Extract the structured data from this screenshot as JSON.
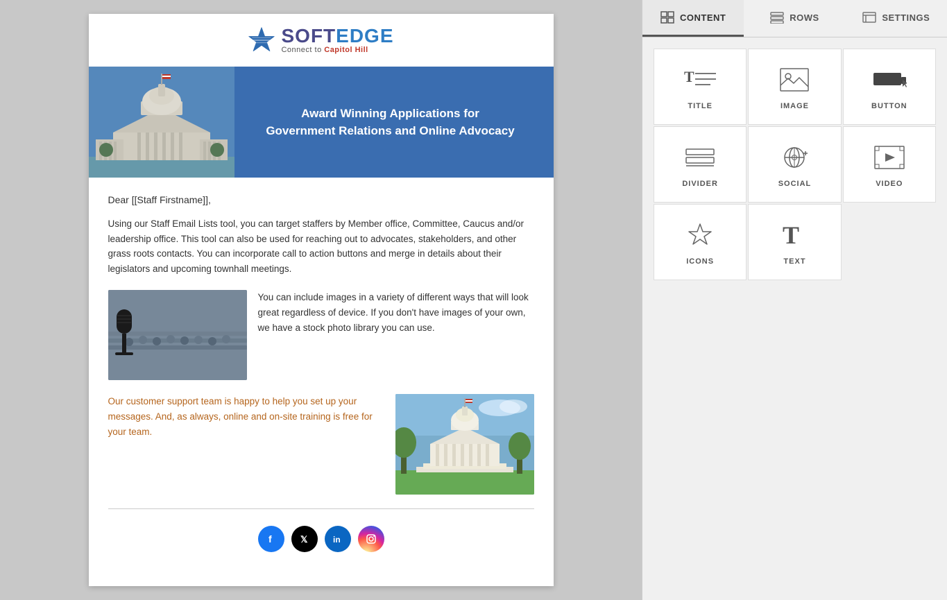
{
  "sidebar": {
    "tabs": [
      {
        "id": "content",
        "label": "CONTENT",
        "active": true
      },
      {
        "id": "rows",
        "label": "ROWS",
        "active": false
      },
      {
        "id": "settings",
        "label": "SETTINGS",
        "active": false
      }
    ],
    "content_items": [
      {
        "id": "title",
        "label": "TITLE"
      },
      {
        "id": "image",
        "label": "IMAGE"
      },
      {
        "id": "button",
        "label": "BUTTON"
      },
      {
        "id": "divider",
        "label": "DIVIDER"
      },
      {
        "id": "social",
        "label": "SOCIAL"
      },
      {
        "id": "video",
        "label": "VIDEO"
      },
      {
        "id": "icons",
        "label": "ICONS"
      },
      {
        "id": "text",
        "label": "TEXT"
      }
    ]
  },
  "email": {
    "logo": {
      "soft": "SOFT",
      "edge": "EDGE",
      "tagline_prefix": "Connect to ",
      "tagline_highlight": "Capitol Hill"
    },
    "hero": {
      "line1": "Award Winning Applications for",
      "line2": "Government Relations and Online Advocacy"
    },
    "greeting": "Dear [[Staff Firstname]],",
    "paragraph1": "Using our Staff Email Lists tool, you can target staffers by Member office, Committee, Caucus and/or leadership office. This tool can also be used for reaching out to advocates, stakeholders, and other grass roots contacts. You can incorporate call to action buttons and merge in details about their legislators and upcoming townhall meetings.",
    "col1_text": "You can include images in a variety of different ways that will look great regardless of device. If you don't have images of your own, we have a stock photo library you can use.",
    "col2_text": "Our customer support team is happy to help you set up your messages. And, as always, online and on-site training is free for your team.",
    "social_icons": [
      {
        "id": "facebook",
        "label": "f"
      },
      {
        "id": "twitter-x",
        "label": "𝕏"
      },
      {
        "id": "linkedin",
        "label": "in"
      },
      {
        "id": "instagram",
        "label": "ig"
      }
    ]
  }
}
